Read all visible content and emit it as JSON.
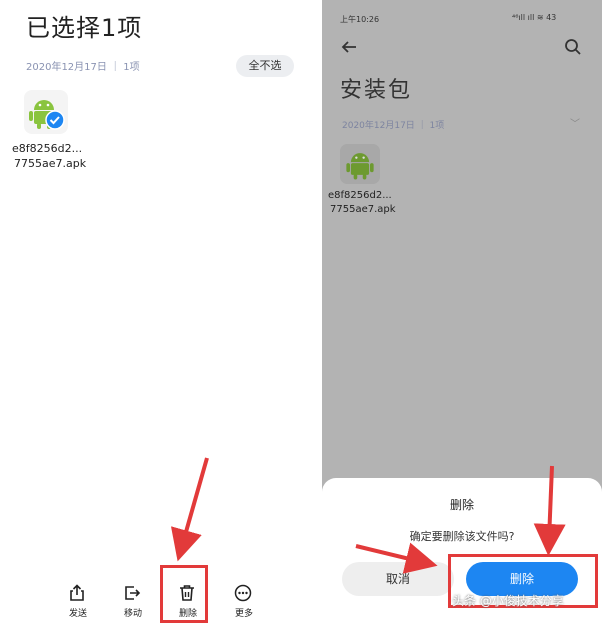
{
  "left": {
    "title": "已选择1项",
    "date_info": "2020年12月17日 ｜ 1项",
    "deselect_label": "全不选",
    "file": {
      "name_line1": "e8f8256d2...",
      "name_line2": "7755ae7.apk",
      "selected": true
    },
    "toolbar": [
      {
        "label": "发送",
        "icon": "share-icon"
      },
      {
        "label": "移动",
        "icon": "move-icon"
      },
      {
        "label": "删除",
        "icon": "trash-icon"
      },
      {
        "label": "更多",
        "icon": "more-icon"
      }
    ]
  },
  "right": {
    "status": {
      "time": "上午10:26",
      "icons": "⁴⁶ıll ıll ≋ 43"
    },
    "title": "安装包",
    "date_info": "2020年12月17日 ｜ 1项",
    "file": {
      "name_line1": "e8f8256d2...",
      "name_line2": "7755ae7.apk"
    },
    "dialog": {
      "title": "删除",
      "message": "确定要删除该文件吗?",
      "cancel_label": "取消",
      "confirm_label": "删除"
    }
  },
  "watermark": "头条 @小俊技术分享",
  "colors": {
    "accent": "#1d86f2",
    "annotation": "#e23a3a",
    "android": "#8ac43f"
  }
}
